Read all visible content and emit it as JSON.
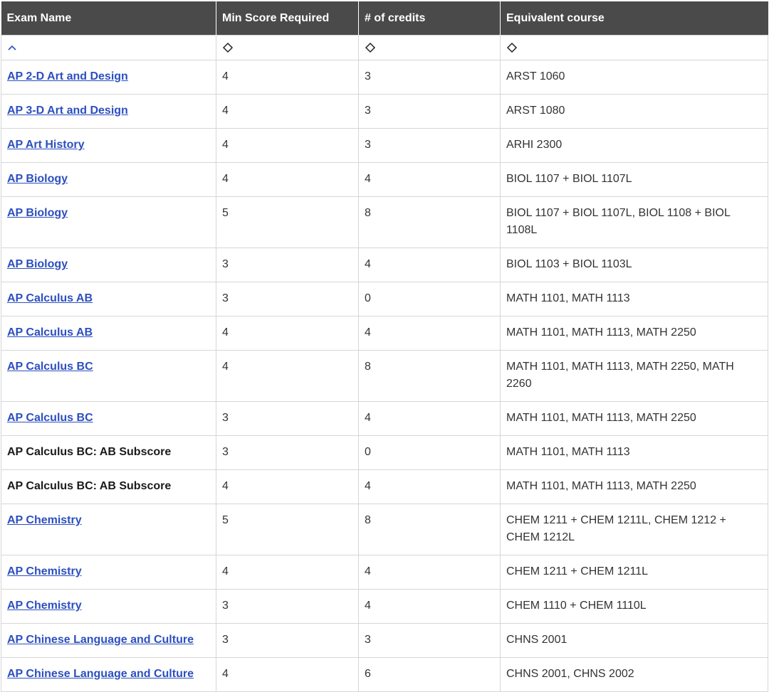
{
  "headers": {
    "exam_name": "Exam Name",
    "min_score": "Min Score Required",
    "credits": "# of credits",
    "equivalent": "Equivalent course"
  },
  "sort_icons": {
    "exam_name": "chevron-up-icon",
    "min_score": "sort-diamond-icon",
    "credits": "sort-diamond-icon",
    "equivalent": "sort-diamond-icon"
  },
  "colors": {
    "header_bg": "#4a4a4a",
    "link": "#2c4fbf",
    "border": "#d6d6d6"
  },
  "rows": [
    {
      "exam": "AP 2-D Art and Design",
      "link": true,
      "score": "4",
      "credits": "3",
      "equiv": "ARST 1060"
    },
    {
      "exam": "AP 3-D Art and Design",
      "link": true,
      "score": "4",
      "credits": "3",
      "equiv": "ARST 1080"
    },
    {
      "exam": "AP Art History",
      "link": true,
      "score": "4",
      "credits": "3",
      "equiv": "ARHI 2300"
    },
    {
      "exam": "AP Biology",
      "link": true,
      "score": "4",
      "credits": "4",
      "equiv": "BIOL 1107 + BIOL 1107L"
    },
    {
      "exam": "AP Biology",
      "link": true,
      "score": "5",
      "credits": "8",
      "equiv": "BIOL 1107 + BIOL 1107L, BIOL 1108 + BIOL 1108L"
    },
    {
      "exam": "AP Biology",
      "link": true,
      "score": "3",
      "credits": "4",
      "equiv": "BIOL 1103 + BIOL 1103L"
    },
    {
      "exam": "AP Calculus AB",
      "link": true,
      "score": "3",
      "credits": "0",
      "equiv": "MATH 1101, MATH 1113"
    },
    {
      "exam": "AP Calculus AB",
      "link": true,
      "score": "4",
      "credits": "4",
      "equiv": "MATH 1101, MATH 1113, MATH 2250"
    },
    {
      "exam": "AP Calculus BC",
      "link": true,
      "score": "4",
      "credits": "8",
      "equiv": "MATH 1101, MATH 1113, MATH 2250, MATH 2260"
    },
    {
      "exam": "AP Calculus BC",
      "link": true,
      "score": "3",
      "credits": "4",
      "equiv": "MATH 1101, MATH 1113, MATH 2250"
    },
    {
      "exam": "AP Calculus BC: AB Subscore",
      "link": false,
      "score": "3",
      "credits": "0",
      "equiv": "MATH 1101, MATH 1113"
    },
    {
      "exam": "AP Calculus BC: AB Subscore",
      "link": false,
      "score": "4",
      "credits": "4",
      "equiv": "MATH 1101, MATH 1113, MATH 2250"
    },
    {
      "exam": "AP Chemistry",
      "link": true,
      "score": "5",
      "credits": "8",
      "equiv": "CHEM 1211 + CHEM 1211L, CHEM 1212 + CHEM 1212L"
    },
    {
      "exam": "AP Chemistry",
      "link": true,
      "score": "4",
      "credits": "4",
      "equiv": "CHEM 1211 + CHEM 1211L"
    },
    {
      "exam": "AP Chemistry",
      "link": true,
      "score": "3",
      "credits": "4",
      "equiv": "CHEM 1110 + CHEM 1110L"
    },
    {
      "exam": "AP Chinese Language and Culture",
      "link": true,
      "score": "3",
      "credits": "3",
      "equiv": "CHNS 2001"
    },
    {
      "exam": "AP Chinese Language and Culture",
      "link": true,
      "score": "4",
      "credits": "6",
      "equiv": "CHNS 2001, CHNS 2002"
    }
  ]
}
